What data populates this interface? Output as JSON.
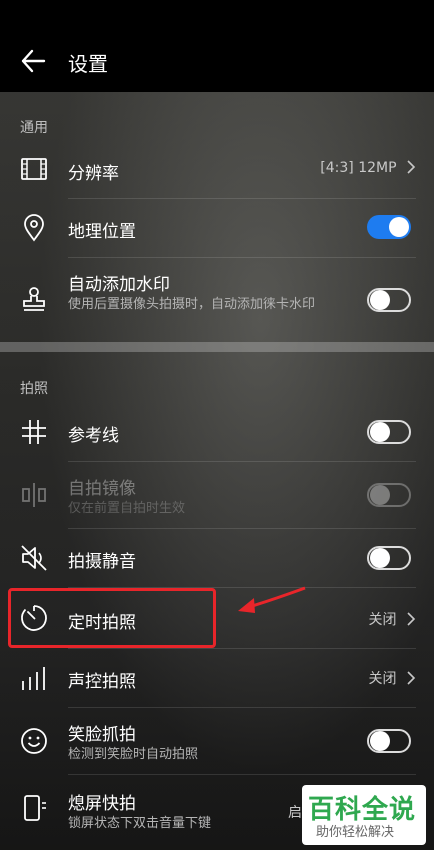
{
  "header": {
    "title": "设置"
  },
  "sections": {
    "general": "通用",
    "shooting": "拍照"
  },
  "rows": {
    "resolution": {
      "label": "分辨率",
      "value": "[4:3] 12MP"
    },
    "location": {
      "label": "地理位置",
      "enabled": true
    },
    "watermark": {
      "label": "自动添加水印",
      "desc": "使用后置摄像头拍摄时，自动添加徕卡水印",
      "enabled": false
    },
    "grid": {
      "label": "参考线",
      "enabled": false
    },
    "mirror": {
      "label": "自拍镜像",
      "desc": "仅在前置自拍时生效",
      "enabled": false,
      "disabled": true
    },
    "mute": {
      "label": "拍摄静音",
      "enabled": false
    },
    "timer": {
      "label": "定时拍照",
      "value": "关闭"
    },
    "voice": {
      "label": "声控拍照",
      "value": "关闭"
    },
    "smile": {
      "label": "笑脸抓拍",
      "desc": "检测到笑脸时自动拍照",
      "enabled": false
    },
    "ultra": {
      "label": "熄屏快拍",
      "desc": "锁屏状态下双击音量下键",
      "value_partial": "启"
    }
  },
  "watermark_logo": {
    "main": "百科全说",
    "sub": "助你轻松解决"
  },
  "colors": {
    "accent": "#1e7cf0",
    "highlight": "#e8252a",
    "logo": "#2fa84f"
  }
}
